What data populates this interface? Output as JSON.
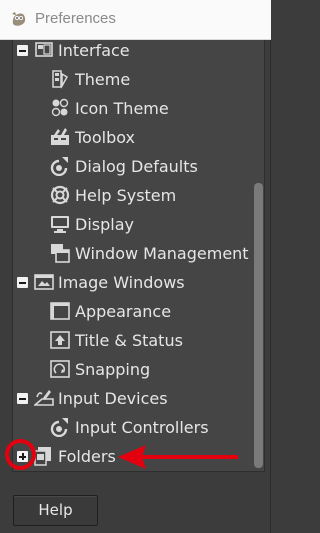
{
  "window": {
    "title": "Preferences"
  },
  "tree": {
    "items": [
      {
        "label": "Interface",
        "level": 0,
        "expander": "minus",
        "icon": "interface-icon"
      },
      {
        "label": "Theme",
        "level": 1,
        "icon": "theme-icon"
      },
      {
        "label": "Icon Theme",
        "level": 1,
        "icon": "icon-theme-icon"
      },
      {
        "label": "Toolbox",
        "level": 1,
        "icon": "toolbox-icon"
      },
      {
        "label": "Dialog Defaults",
        "level": 1,
        "icon": "dialog-defaults-icon"
      },
      {
        "label": "Help System",
        "level": 1,
        "icon": "help-system-icon"
      },
      {
        "label": "Display",
        "level": 1,
        "icon": "display-icon"
      },
      {
        "label": "Window Management",
        "level": 1,
        "icon": "window-management-icon"
      },
      {
        "label": "Image Windows",
        "level": 0,
        "expander": "minus",
        "icon": "image-windows-icon"
      },
      {
        "label": "Appearance",
        "level": 1,
        "icon": "appearance-icon"
      },
      {
        "label": "Title & Status",
        "level": 1,
        "icon": "title-status-icon"
      },
      {
        "label": "Snapping",
        "level": 1,
        "icon": "snapping-icon"
      },
      {
        "label": "Input Devices",
        "level": 0,
        "expander": "minus",
        "icon": "input-devices-icon"
      },
      {
        "label": "Input Controllers",
        "level": 1,
        "icon": "input-controllers-icon"
      },
      {
        "label": "Folders",
        "level": 0,
        "expander": "plus",
        "icon": "folders-icon"
      }
    ]
  },
  "buttons": {
    "help_label": "Help"
  },
  "colors": {
    "panel_bg": "#454545",
    "window_bg": "#3c3c3c",
    "annotation": "#e3000f"
  }
}
